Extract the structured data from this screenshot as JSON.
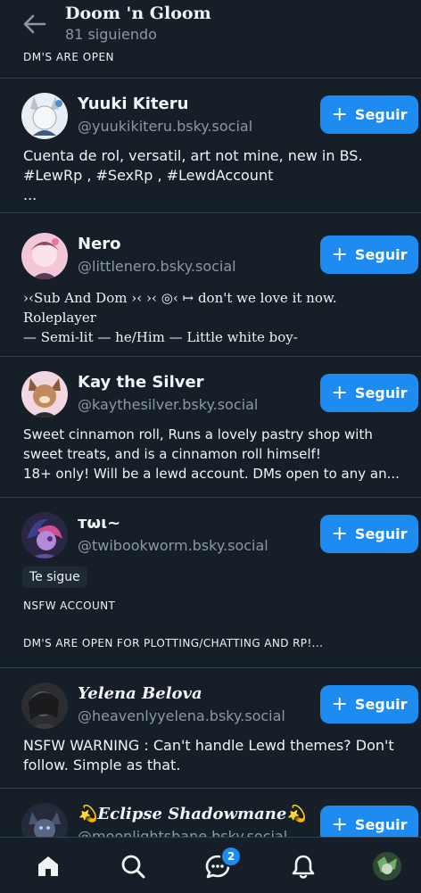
{
  "header": {
    "title": "Doom 'n Gloom",
    "subtitle": "81 siguiendo",
    "bio_tail": "DM'S ARE OPEN"
  },
  "follow_label": "Seguir",
  "accounts": [
    {
      "name": "Yuuki Kiteru",
      "handle": "@yuukikiteru.bsky.social",
      "bio": "Cuenta de rol, versatil, art not mine, new in BS.\n#LewRp , #SexRp , #LewdAccount\n..."
    },
    {
      "name": "Nero",
      "handle": "@littlenero.bsky.social",
      "bio": "›‹Sub And Dom ›‹ ›‹ ◎‹ ↦ don't we love it now. Roleplayer\n— Semi-lit — he/Him — Little white boy-\n..."
    },
    {
      "name": "Kay the Silver",
      "handle": "@kaythesilver.bsky.social",
      "bio": "Sweet cinnamon roll, Runs a lovely pastry shop with sweet treats, and is a cinnamon roll himself!\n18+ only! Will be a lewd account. DMs open to any an..."
    },
    {
      "name": "ᴛωι~",
      "handle": "@twibookworm.bsky.social",
      "badge": "Te sigue",
      "bio_line1": "NSFW ACCOUNT",
      "bio_line2": "DM'S ARE OPEN FOR PLOTTING/CHATTING AND RP!..."
    },
    {
      "name": "Yelena Belova",
      "handle": "@heavenlyyelena.bsky.social",
      "bio": "NSFW WARNING : Can't handle Lewd themes? Don't follow. Simple as that."
    },
    {
      "name": "💫Eclipse Shadowmane💫",
      "handle": "@moonlightsbane.bsky.social"
    }
  ],
  "tabbar": {
    "chat_badge": "2",
    "icons": [
      "home-icon",
      "search-icon",
      "chat-icon",
      "bell-icon",
      "profile-avatar"
    ]
  },
  "colors": {
    "background": "#161e27",
    "accent": "#1d8bf0",
    "muted_text": "#8b98a5",
    "divider": "#2e4052"
  }
}
